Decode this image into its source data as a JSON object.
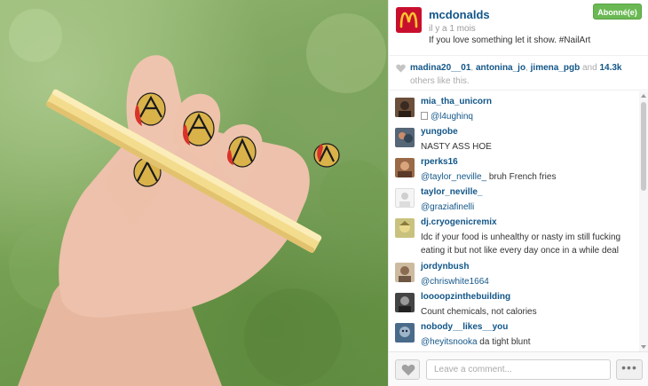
{
  "post": {
    "username": "mcdonalds",
    "time": "il y a 1 mois",
    "caption": "If you love something let it show. #NailArt",
    "follow_label": "Abonné(e)",
    "avatar_icon": "mcdonalds-logo",
    "colors": {
      "accent": "#125688",
      "follow": "#6bb955",
      "brand": "#c8102e"
    }
  },
  "likes": {
    "users": [
      "madina20__01",
      "antonina_jo",
      "jimena_pgb"
    ],
    "separator": ", ",
    "and_text": " and ",
    "count": "14.3k",
    "suffix": "others like this.",
    "icon": "heart-icon"
  },
  "comments": [
    {
      "user": "mia_tha_unicorn",
      "mention": "@l4ughinq",
      "prefix": "\u0000",
      "text": "",
      "avatar_color": "#6b4f3a"
    },
    {
      "user": "yungobe",
      "mention": "",
      "text": "NASTY ASS HOE",
      "avatar_color": "#445566"
    },
    {
      "user": "rperks16",
      "mention": "@taylor_neville_",
      "text": " bruh French fries",
      "avatar_color": "#8a5a3c"
    },
    {
      "user": "taylor_neville_",
      "mention": "@graziafinelli",
      "text": "",
      "avatar_color": "#ffffff"
    },
    {
      "user": "dj.cryogenicremix",
      "mention": "",
      "text": "Idc if your food is unhealthy or nasty im still fucking eating it but not like every day once in a while deal",
      "avatar_color": "#b8b070"
    },
    {
      "user": "jordynbush",
      "mention": "@chriswhite1664",
      "text": "",
      "avatar_color": "#b9a58a"
    },
    {
      "user": "loooopzinthebuilding",
      "mention": "",
      "text": "Count chemicals, not calories",
      "avatar_color": "#3a3a3a"
    },
    {
      "user": "nobody__likes__you",
      "mention": "@heyitsnooka",
      "text": " da tight blunt",
      "avatar_color": "#4a6a8a"
    }
  ],
  "footer": {
    "comment_placeholder": "Leave a comment...",
    "more_label": "•••"
  }
}
